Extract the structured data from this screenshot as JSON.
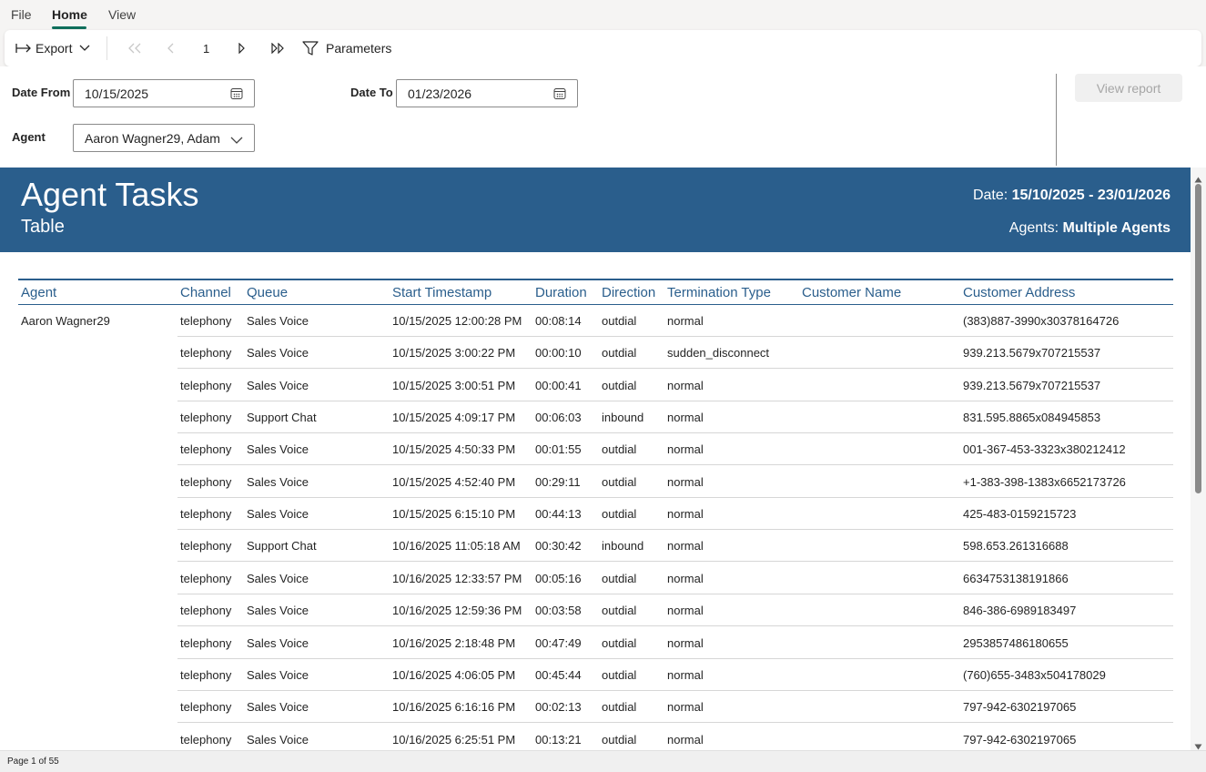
{
  "menu": {
    "file": "File",
    "home": "Home",
    "view": "View"
  },
  "toolbar": {
    "export_label": "Export",
    "page_number": "1",
    "parameters_label": "Parameters"
  },
  "parameters": {
    "date_from_label": "Date From",
    "date_from_value": "10/15/2025",
    "date_to_label": "Date To",
    "date_to_value": "01/23/2026",
    "agent_label": "Agent",
    "agent_value": "Aaron Wagner29, Adam",
    "view_report_label": "View report"
  },
  "report": {
    "title": "Agent Tasks",
    "subtitle": "Table",
    "date_label": "Date: ",
    "date_value": "15/10/2025 - 23/01/2026",
    "agents_label": "Agents: ",
    "agents_value": "Multiple Agents",
    "columns": [
      "Agent",
      "Channel",
      "Queue",
      "Start Timestamp",
      "Duration",
      "Direction",
      "Termination Type",
      "Customer Name",
      "Customer Address"
    ],
    "agent_name": "Aaron Wagner29",
    "rows": [
      {
        "channel": "telephony",
        "queue": "Sales Voice",
        "start": "10/15/2025 12:00:28 PM",
        "duration": "00:08:14",
        "direction": "outdial",
        "termination": "normal",
        "customer_name": "",
        "address": "(383)887-3990x30378164726"
      },
      {
        "channel": "telephony",
        "queue": "Sales Voice",
        "start": "10/15/2025 3:00:22 PM",
        "duration": "00:00:10",
        "direction": "outdial",
        "termination": "sudden_disconnect",
        "customer_name": "",
        "address": "939.213.5679x707215537"
      },
      {
        "channel": "telephony",
        "queue": "Sales Voice",
        "start": "10/15/2025 3:00:51 PM",
        "duration": "00:00:41",
        "direction": "outdial",
        "termination": "normal",
        "customer_name": "",
        "address": "939.213.5679x707215537"
      },
      {
        "channel": "telephony",
        "queue": "Support Chat",
        "start": "10/15/2025 4:09:17 PM",
        "duration": "00:06:03",
        "direction": "inbound",
        "termination": "normal",
        "customer_name": "",
        "address": "831.595.8865x084945853"
      },
      {
        "channel": "telephony",
        "queue": "Sales Voice",
        "start": "10/15/2025 4:50:33 PM",
        "duration": "00:01:55",
        "direction": "outdial",
        "termination": "normal",
        "customer_name": "",
        "address": "001-367-453-3323x380212412"
      },
      {
        "channel": "telephony",
        "queue": "Sales Voice",
        "start": "10/15/2025 4:52:40 PM",
        "duration": "00:29:11",
        "direction": "outdial",
        "termination": "normal",
        "customer_name": "",
        "address": "+1-383-398-1383x6652173726"
      },
      {
        "channel": "telephony",
        "queue": "Sales Voice",
        "start": "10/15/2025 6:15:10 PM",
        "duration": "00:44:13",
        "direction": "outdial",
        "termination": "normal",
        "customer_name": "",
        "address": "425-483-0159215723"
      },
      {
        "channel": "telephony",
        "queue": "Support Chat",
        "start": "10/16/2025 11:05:18 AM",
        "duration": "00:30:42",
        "direction": "inbound",
        "termination": "normal",
        "customer_name": "",
        "address": "598.653.261316688"
      },
      {
        "channel": "telephony",
        "queue": "Sales Voice",
        "start": "10/16/2025 12:33:57 PM",
        "duration": "00:05:16",
        "direction": "outdial",
        "termination": "normal",
        "customer_name": "",
        "address": "6634753138191866"
      },
      {
        "channel": "telephony",
        "queue": "Sales Voice",
        "start": "10/16/2025 12:59:36 PM",
        "duration": "00:03:58",
        "direction": "outdial",
        "termination": "normal",
        "customer_name": "",
        "address": "846-386-6989183497"
      },
      {
        "channel": "telephony",
        "queue": "Sales Voice",
        "start": "10/16/2025 2:18:48 PM",
        "duration": "00:47:49",
        "direction": "outdial",
        "termination": "normal",
        "customer_name": "",
        "address": "2953857486180655"
      },
      {
        "channel": "telephony",
        "queue": "Sales Voice",
        "start": "10/16/2025 4:06:05 PM",
        "duration": "00:45:44",
        "direction": "outdial",
        "termination": "normal",
        "customer_name": "",
        "address": "(760)655-3483x504178029"
      },
      {
        "channel": "telephony",
        "queue": "Sales Voice",
        "start": "10/16/2025 6:16:16 PM",
        "duration": "00:02:13",
        "direction": "outdial",
        "termination": "normal",
        "customer_name": "",
        "address": "797-942-6302197065"
      },
      {
        "channel": "telephony",
        "queue": "Sales Voice",
        "start": "10/16/2025 6:25:51 PM",
        "duration": "00:13:21",
        "direction": "outdial",
        "termination": "normal",
        "customer_name": "",
        "address": "797-942-6302197065"
      }
    ]
  },
  "status": {
    "page_info": "Page 1 of 55"
  },
  "colors": {
    "accent": "#0f6f5c",
    "banner": "#2a5e8c"
  }
}
